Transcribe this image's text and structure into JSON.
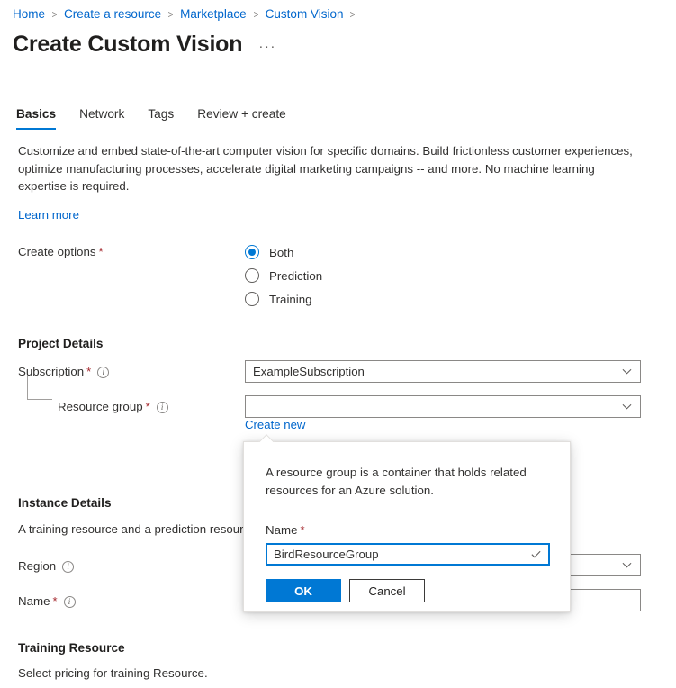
{
  "breadcrumb": {
    "items": [
      "Home",
      "Create a resource",
      "Marketplace",
      "Custom Vision"
    ],
    "separator": ">"
  },
  "header": {
    "title": "Create Custom Vision",
    "more_label": "···"
  },
  "tabs": [
    {
      "label": "Basics",
      "active": true
    },
    {
      "label": "Network",
      "active": false
    },
    {
      "label": "Tags",
      "active": false
    },
    {
      "label": "Review + create",
      "active": false
    }
  ],
  "intro": {
    "description": "Customize and embed state-of-the-art computer vision for specific domains. Build frictionless customer experiences, optimize manufacturing processes, accelerate digital marketing campaigns -- and more. No machine learning expertise is required.",
    "learn_more": "Learn more"
  },
  "create_options": {
    "label": "Create options",
    "required_mark": "*",
    "options": [
      {
        "label": "Both",
        "selected": true
      },
      {
        "label": "Prediction",
        "selected": false
      },
      {
        "label": "Training",
        "selected": false
      }
    ]
  },
  "project_details": {
    "heading": "Project Details",
    "subscription": {
      "label": "Subscription",
      "required_mark": "*",
      "value": "ExampleSubscription"
    },
    "resource_group": {
      "label": "Resource group",
      "required_mark": "*",
      "value": "",
      "create_new_link": "Create new"
    }
  },
  "instance_details": {
    "heading": "Instance Details",
    "description": "A training resource and a prediction resourc",
    "region": {
      "label": "Region",
      "value": ""
    },
    "name": {
      "label": "Name",
      "required_mark": "*",
      "value": ""
    }
  },
  "training_resource": {
    "heading": "Training Resource",
    "description": "Select pricing for training Resource."
  },
  "create_rg_dialog": {
    "description": "A resource group is a container that holds related resources for an Azure solution.",
    "name_label": "Name",
    "required_mark": "*",
    "name_value": "BirdResourceGroup",
    "ok_label": "OK",
    "cancel_label": "Cancel"
  },
  "colors": {
    "accent": "#0078d4",
    "link": "#0066cc",
    "required": "#a4262c",
    "border": "#8a8886",
    "text": "#323130"
  }
}
